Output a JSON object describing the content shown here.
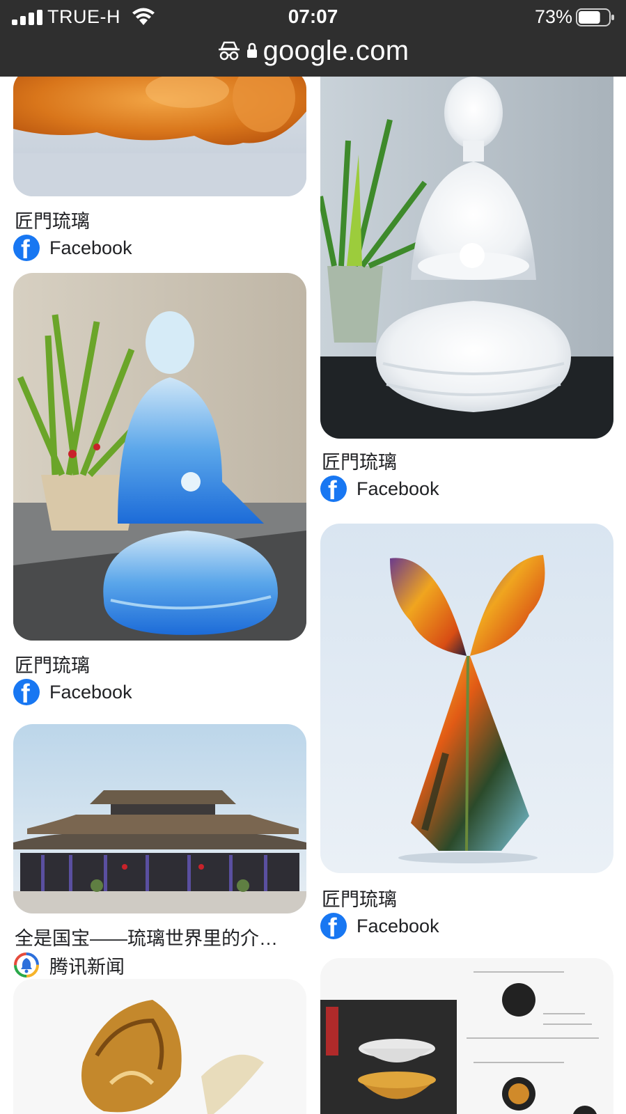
{
  "status_bar": {
    "carrier": "TRUE-H",
    "time": "07:07",
    "battery_percent": "73%",
    "battery_level": 0.73
  },
  "browser": {
    "url": "google.com",
    "icons": [
      "incognito-icon",
      "lock-icon"
    ]
  },
  "results": [
    {
      "title": "匠門琉璃",
      "source": "Facebook",
      "source_icon": "facebook-icon",
      "image": "amber-glass-buddha-image"
    },
    {
      "title": "匠門琉璃",
      "source": "Facebook",
      "source_icon": "facebook-icon",
      "image": "white-crystal-buddha-image"
    },
    {
      "title": "匠門琉璃",
      "source": "Facebook",
      "source_icon": "facebook-icon",
      "image": "blue-glass-buddha-image"
    },
    {
      "title": "匠門琉璃",
      "source": "Facebook",
      "source_icon": "facebook-icon",
      "image": "butterfly-glass-sculpture-image"
    },
    {
      "title": "全是国宝——琉璃世界里的介…",
      "source": "腾讯新闻",
      "source_icon": "tencent-news-icon",
      "image": "temple-building-image"
    },
    {
      "image": "golden-glass-artwork-image"
    },
    {
      "image": "tea-bowl-product-sheet-image"
    }
  ]
}
